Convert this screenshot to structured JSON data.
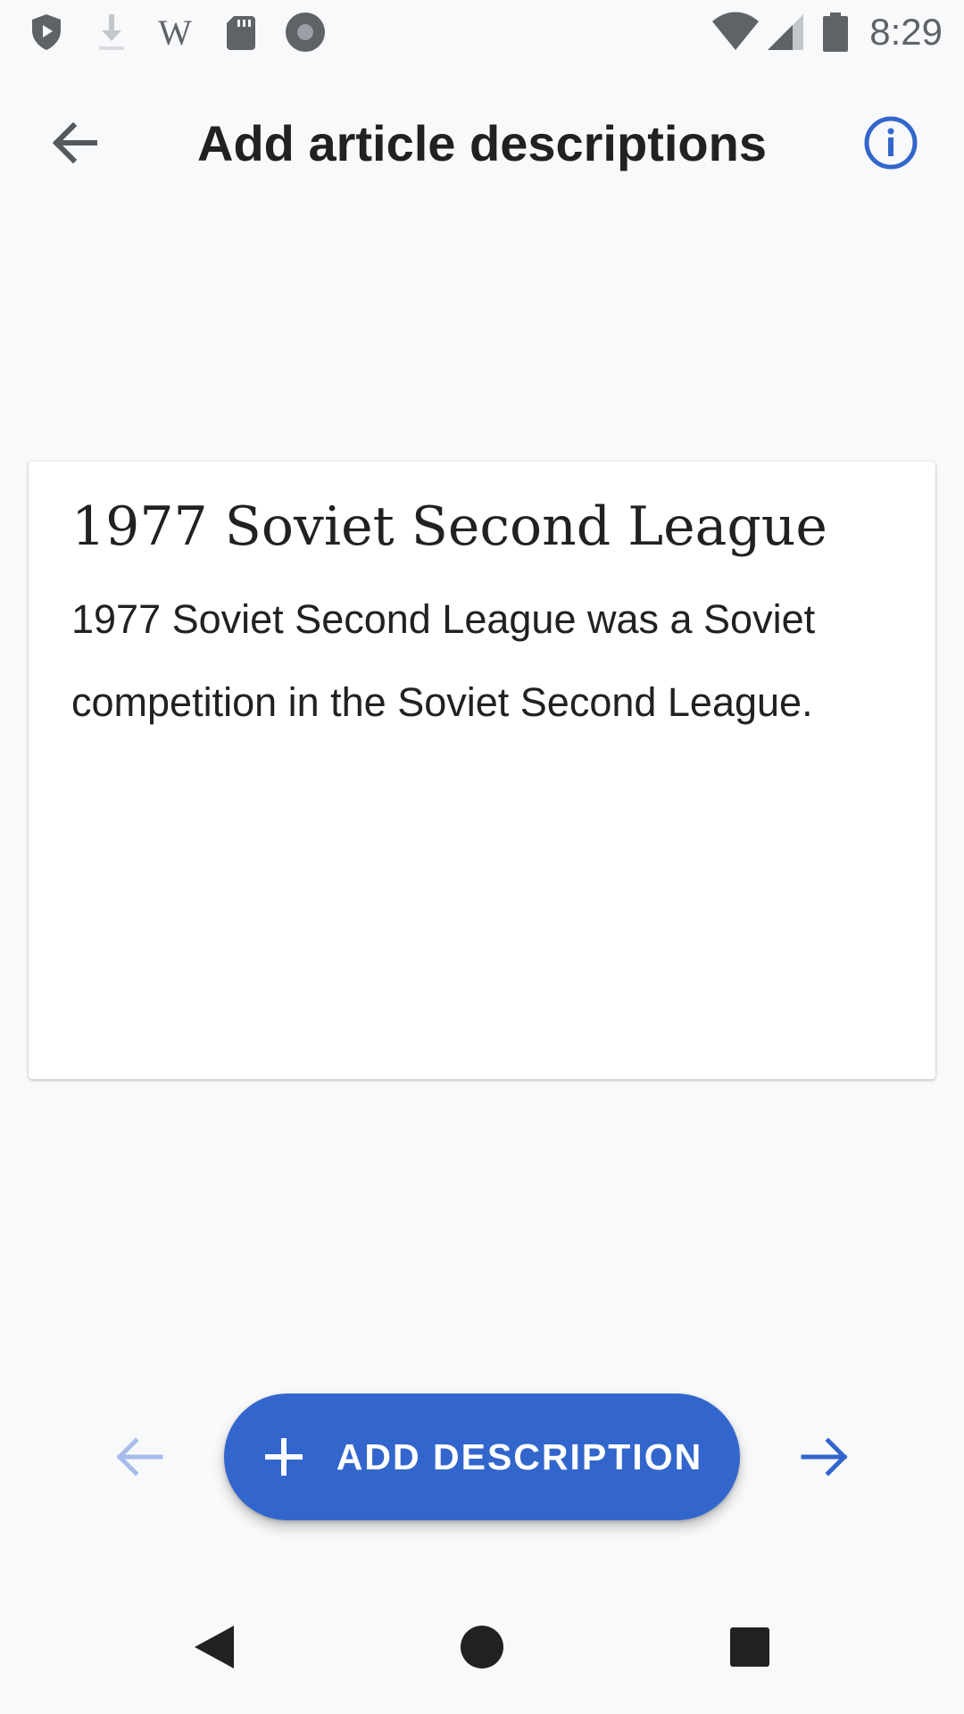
{
  "status_bar": {
    "time": "8:29",
    "icons": [
      "shield-play-icon",
      "download-icon",
      "wikipedia-icon",
      "sd-card-icon",
      "record-icon",
      "wifi-icon",
      "signal-icon",
      "battery-icon"
    ]
  },
  "toolbar": {
    "title": "Add article descriptions",
    "back_icon": "arrow-back-icon",
    "info_icon": "info-icon"
  },
  "card": {
    "title": "1977 Soviet Second League",
    "extract": "1977 Soviet Second League was a Soviet competition in the Soviet Second League."
  },
  "actions": {
    "add_label": "ADD DESCRIPTION",
    "prev_icon": "arrow-back-icon",
    "next_icon": "arrow-forward-icon"
  },
  "nav_bar": {
    "icons": [
      "back-triangle-icon",
      "home-circle-icon",
      "recents-square-icon"
    ]
  },
  "colors": {
    "accent": "#3366cc",
    "background": "#f8f9fa",
    "text": "#202122",
    "status_icon": "#5f6368"
  }
}
